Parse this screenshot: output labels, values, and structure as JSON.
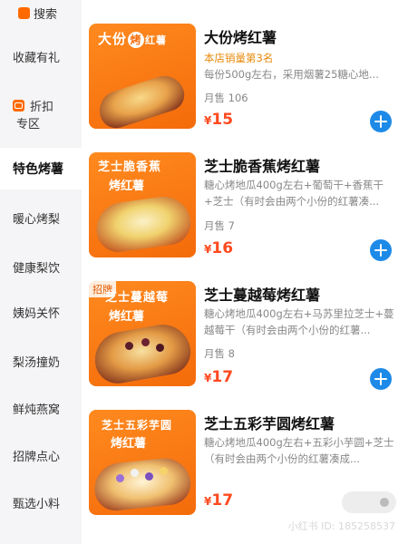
{
  "sidebar": {
    "top_label": "搜索",
    "items": [
      {
        "label": "收藏有礼"
      },
      {
        "label": "折扣",
        "label2": "专区"
      },
      {
        "label": "特色烤薯"
      },
      {
        "label": "暖心烤梨"
      },
      {
        "label": "健康梨饮"
      },
      {
        "label": "姨妈关怀"
      },
      {
        "label": "梨汤撞奶"
      },
      {
        "label": "鲜炖燕窝"
      },
      {
        "label": "招牌点心"
      },
      {
        "label": "甄选小料"
      }
    ]
  },
  "products": [
    {
      "name": "大份烤红薯",
      "rank": "本店销量第3名",
      "desc": "每份500g左右，采用烟薯25糖心地...",
      "sales": "月售 106",
      "currency": "¥",
      "price": "15",
      "thumb_line1": "大份",
      "thumb_highlight": "烤",
      "thumb_line2": "红薯",
      "thumb_tag": ""
    },
    {
      "name": "芝士脆香蕉烤红薯",
      "rank": "",
      "desc": "糖心烤地瓜400g左右+葡萄干+香蕉干+芝士（有时会由两个小份的红薯凑...",
      "sales": "月售 7",
      "currency": "¥",
      "price": "16",
      "thumb_line1": "芝士脆香蕉",
      "thumb_highlight": "",
      "thumb_line2": "烤红薯",
      "thumb_tag": ""
    },
    {
      "name": "芝士蔓越莓烤红薯",
      "rank": "",
      "desc": "糖心烤地瓜400g左右+马苏里拉芝士+蔓越莓干（有时会由两个小份的红薯...",
      "sales": "月售 8",
      "currency": "¥",
      "price": "17",
      "thumb_line1": "芝士蔓越莓",
      "thumb_highlight": "",
      "thumb_line2": "烤红薯",
      "thumb_tag": "招牌"
    },
    {
      "name": "芝士五彩芋圆烤红薯",
      "rank": "",
      "desc": "糖心烤地瓜400g左右+五彩小芋圆+芝士（有时会由两个小份的红薯凑成...",
      "sales": "",
      "currency": "¥",
      "price": "17",
      "thumb_line1": "芝士五彩芋圆",
      "thumb_highlight": "",
      "thumb_line2": "烤红薯",
      "thumb_tag": ""
    }
  ],
  "watermark": "小红书 ID: 185258537",
  "colors": {
    "accent_orange": "#ff6a00",
    "price_red": "#ff4a1f",
    "add_button_blue": "#1d8ae8",
    "rank_orange": "#e8890a",
    "sidebar_bg": "#f5f5f7"
  },
  "icons": {
    "add": "plus-circle-icon",
    "discount_badge": "discount-badge-icon"
  }
}
